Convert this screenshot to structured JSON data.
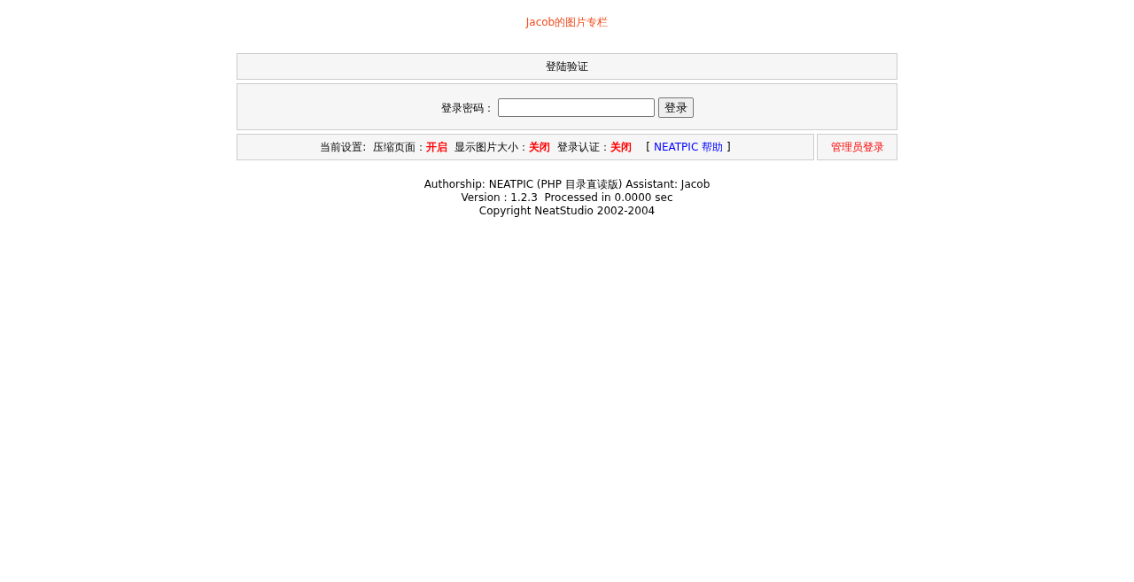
{
  "site_title": "Jacob的图片专栏",
  "login_panel": {
    "heading": "登陆验证",
    "password_label": "登录密码：",
    "submit_button": "登录"
  },
  "settings_bar": {
    "label": "当前设置:",
    "settings": [
      {
        "label": "压缩页面：",
        "value": "开启"
      },
      {
        "label": "显示图片大小：",
        "value": "关闭"
      },
      {
        "label": "登录认证：",
        "value": "关闭"
      }
    ],
    "help_open": "[",
    "help_link": "NEATPIC 帮助",
    "help_close": "]",
    "admin_link": "管理员登录"
  },
  "footer": {
    "lines": [
      "Authorship: NEATPIC (PHP 目录直读版) Assistant: Jacob",
      "Version : 1.2.3  Processed in 0.0000 sec",
      "Copyright NeatStudio 2002-2004"
    ]
  }
}
